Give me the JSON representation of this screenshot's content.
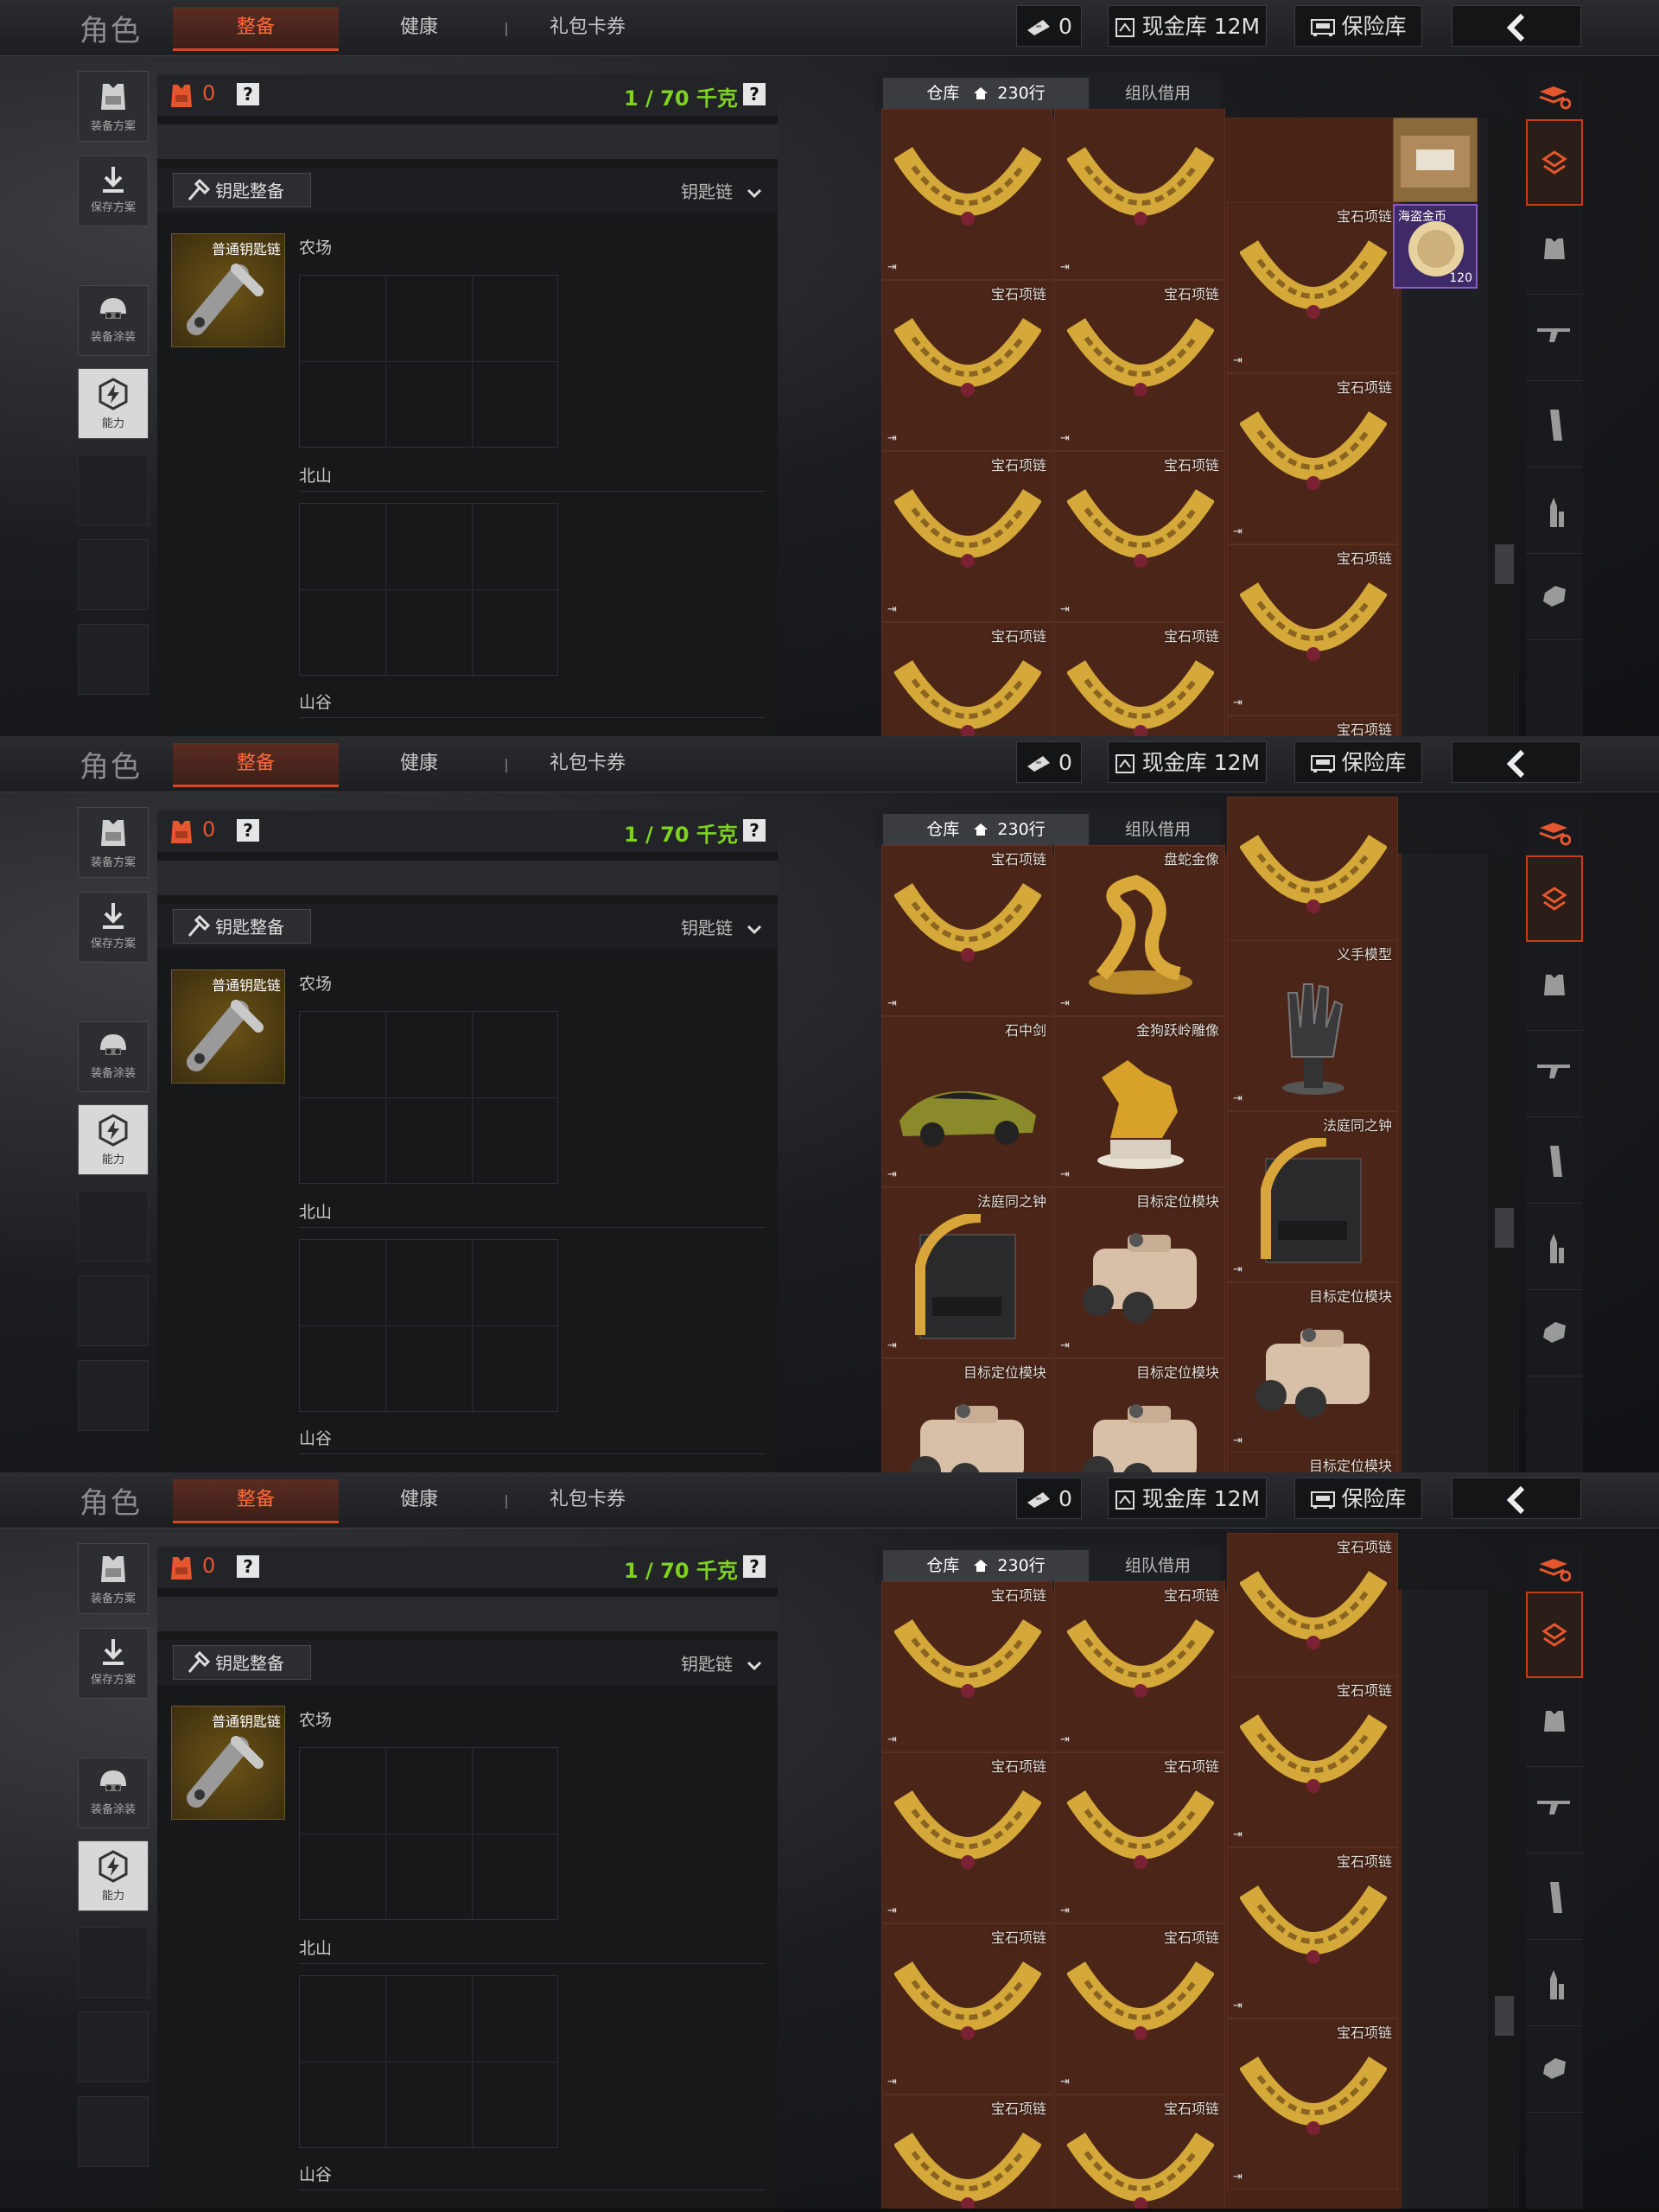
{
  "header": {
    "title": "角色",
    "tabs": [
      "整备",
      "健康",
      "礼包卡券"
    ],
    "ticket_count": "0",
    "cash_label": "现金库 12M",
    "safe_label": "保险库"
  },
  "sidebar": {
    "plan_label": "装备方案",
    "save_label": "保存方案",
    "paint_label": "装备涂装",
    "ability_label": "能力"
  },
  "loadout": {
    "vest_count": "0",
    "weight": "1 / 70 千克",
    "help": "?",
    "key_button": "钥匙整备",
    "key_select": "钥匙链",
    "key_item_name": "普通钥匙链",
    "zones": [
      "农场",
      "北山",
      "山谷"
    ]
  },
  "warehouse": {
    "tab_label": "仓库",
    "tab_count": "230行",
    "team_tab": "组队借用"
  },
  "screens": [
    {
      "items": [
        {
          "name": "",
          "kind": "necklace"
        },
        {
          "name": "",
          "kind": "necklace"
        },
        {
          "name": "宝石项链",
          "kind": "necklace"
        },
        {
          "name": "宝石项链",
          "kind": "necklace"
        },
        {
          "name": "宝石项链",
          "kind": "necklace"
        },
        {
          "name": "宝石项链",
          "kind": "necklace"
        },
        {
          "name": "宝石项链",
          "kind": "necklace"
        },
        {
          "name": "宝石项链",
          "kind": "necklace"
        },
        {
          "name": "宝石项链",
          "kind": "necklace"
        },
        {
          "name": "宝石项链",
          "kind": "necklace"
        },
        {
          "name": "宝石项链",
          "kind": "necklace"
        },
        {
          "name": "宝石项链",
          "kind": "necklace"
        }
      ],
      "extra_small": [
        {
          "name": "",
          "kind": "box"
        },
        {
          "name": "海盗金币",
          "count": "120",
          "kind": "coin"
        }
      ]
    },
    {
      "items": [
        {
          "name": "宝石项链",
          "kind": "necklace"
        },
        {
          "name": "盘蛇金像",
          "kind": "snake"
        },
        {
          "name": "",
          "kind": "necklace"
        },
        {
          "name": "义手模型",
          "kind": "hand"
        },
        {
          "name": "石中剑",
          "kind": "car"
        },
        {
          "name": "金狗跃岭雕像",
          "kind": "horse"
        },
        {
          "name": "法庭同之钟",
          "kind": "clock"
        },
        {
          "name": "法庭同之钟",
          "kind": "clock"
        },
        {
          "name": "目标定位模块",
          "kind": "module"
        },
        {
          "name": "目标定位模块",
          "kind": "module"
        },
        {
          "name": "目标定位模块",
          "kind": "module"
        },
        {
          "name": "目标定位模块",
          "kind": "module"
        },
        {
          "name": "目标定位模块",
          "kind": "module"
        }
      ]
    },
    {
      "items": [
        {
          "name": "宝石项链",
          "kind": "necklace"
        },
        {
          "name": "宝石项链",
          "kind": "necklace"
        },
        {
          "name": "宝石项链",
          "kind": "necklace"
        },
        {
          "name": "宝石项链",
          "kind": "necklace"
        },
        {
          "name": "宝石项链",
          "kind": "necklace"
        },
        {
          "name": "宝石项链",
          "kind": "necklace"
        },
        {
          "name": "宝石项链",
          "kind": "necklace"
        },
        {
          "name": "宝石项链",
          "kind": "necklace"
        },
        {
          "name": "宝石项链",
          "kind": "necklace"
        },
        {
          "name": "宝石项链",
          "kind": "necklace"
        },
        {
          "name": "宝石项链",
          "kind": "necklace"
        },
        {
          "name": "宝石项链",
          "kind": "necklace"
        }
      ]
    }
  ],
  "colors": {
    "accent": "#e4572e",
    "weight_green": "#7ed321",
    "grid_bg": "#4b2518",
    "tab_active_bg": "#5a2d22"
  },
  "icons": [
    "vest-icon",
    "question-icon",
    "key-icon",
    "chevron-down-icon",
    "ticket-icon",
    "cash-icon",
    "safe-icon",
    "back-arrow-icon",
    "armor-icon",
    "save-icon",
    "helmet-icon",
    "ability-icon",
    "home-icon",
    "sort-icon",
    "chest-icon",
    "rifle-icon",
    "magazine-icon",
    "ammo-icon",
    "glove-icon"
  ]
}
